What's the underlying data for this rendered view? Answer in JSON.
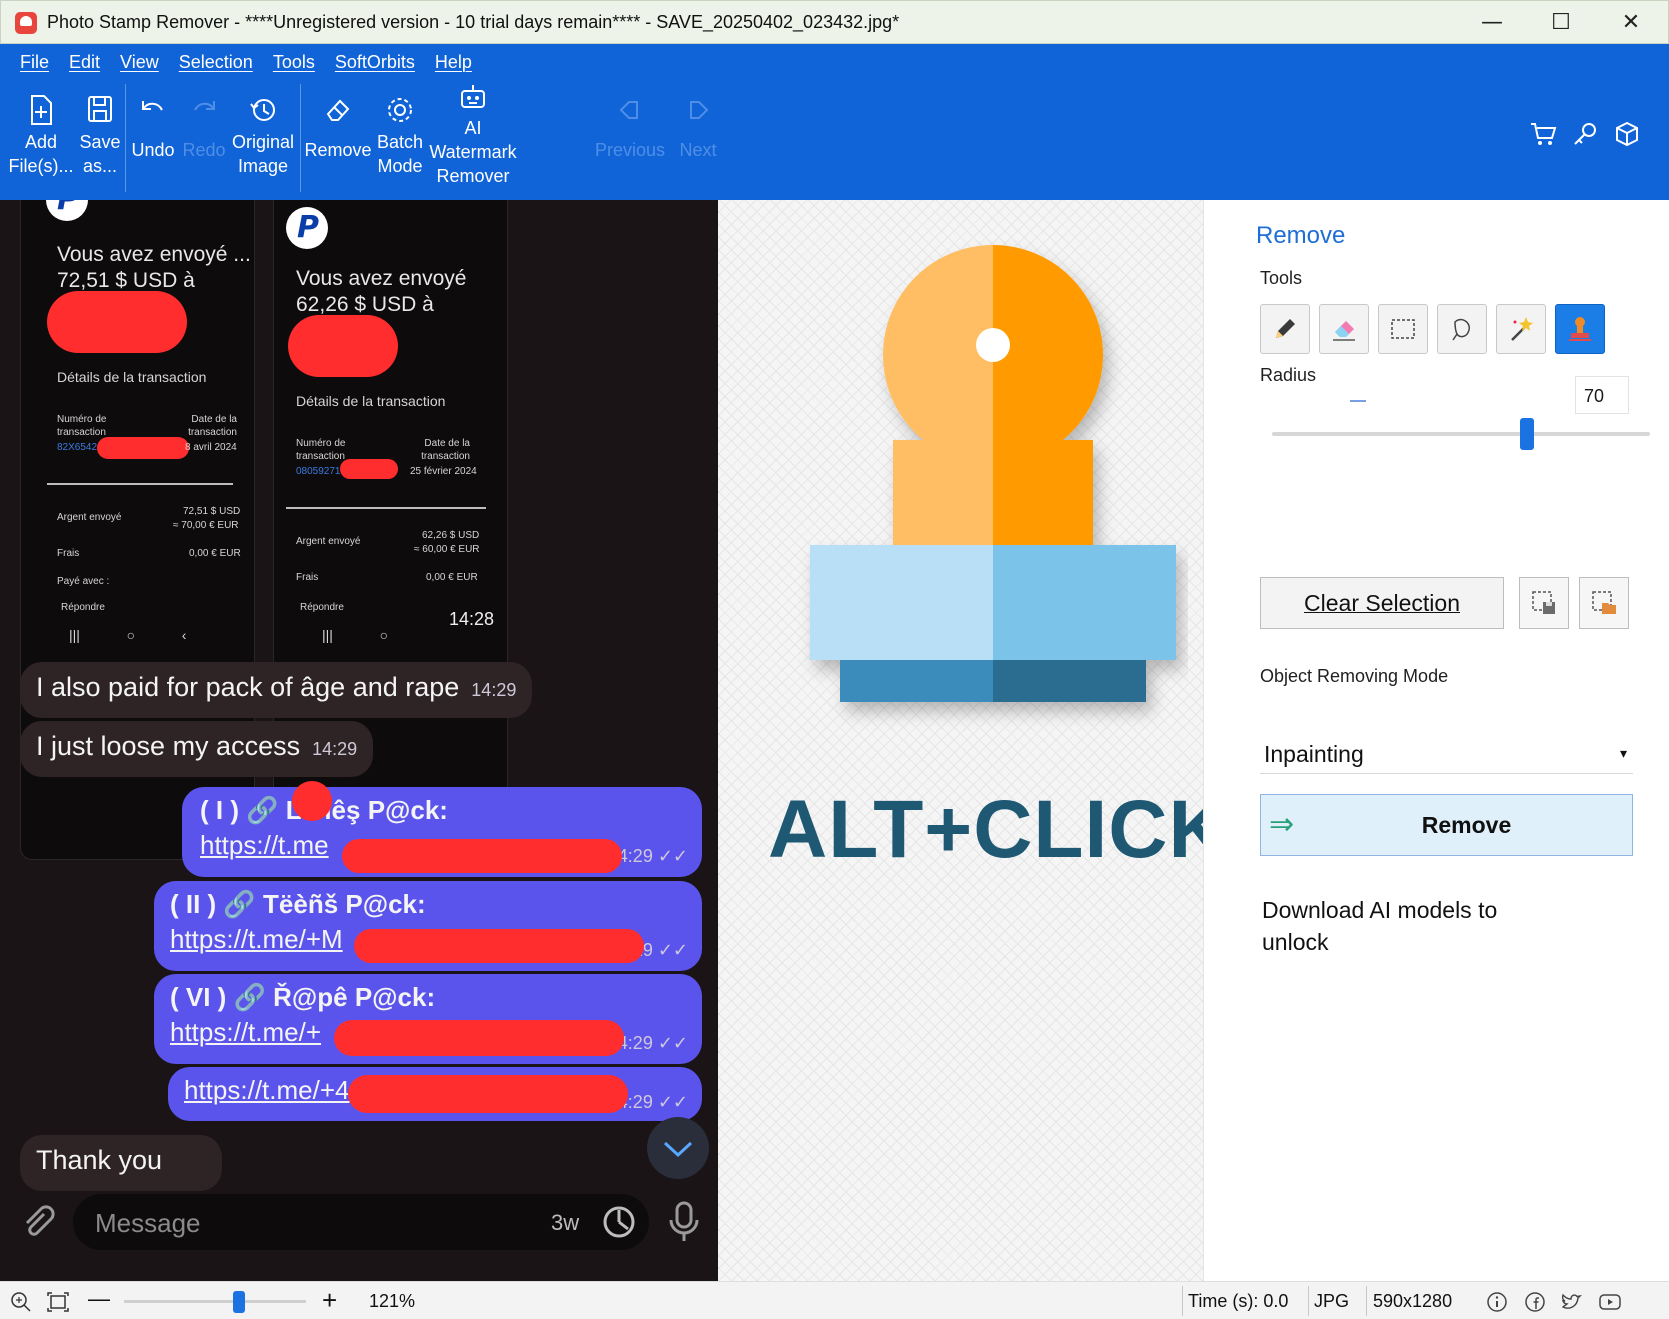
{
  "window": {
    "title": "Photo Stamp Remover - ****Unregistered version - 10 trial days remain**** - SAVE_20250402_023432.jpg*",
    "minimize": "—",
    "maximize": "☐",
    "close": "✕"
  },
  "menu": [
    "File",
    "Edit",
    "View",
    "Selection",
    "Tools",
    "SoftOrbits",
    "Help"
  ],
  "toolbar": {
    "add_line1": "Add",
    "add_line2": "File(s)...",
    "save_line1": "Save",
    "save_line2": "as...",
    "undo": "Undo",
    "redo": "Redo",
    "original_line1": "Original",
    "original_line2": "Image",
    "remove": "Remove",
    "batch_line1": "Batch",
    "batch_line2": "Mode",
    "ai_line1": "AI",
    "ai_line2": "Watermark",
    "ai_line3": "Remover",
    "previous": "Previous",
    "next": "Next",
    "right_icons": [
      "cart-icon",
      "key-icon",
      "box-icon"
    ]
  },
  "image_left": {
    "card1": {
      "title_line1": "Vous avez envoyé ...",
      "title_line2": "72,51 $ USD à",
      "details": "Détails de la transaction",
      "num_label": "Numéro de transaction",
      "num_value": "82X6542",
      "date_label": "Date de la transaction",
      "date_value": "8 avril 2024",
      "sent_label": "Argent envoyé",
      "sent_value1": "72,51 $ USD",
      "sent_value2": "≈ 70,00 € EUR",
      "fees_label": "Frais",
      "fees_value": "0,00 € EUR",
      "paid_with": "Payé avec :",
      "reply": "Répondre"
    },
    "card2": {
      "title_line1": "Vous avez envoyé",
      "title_line2": "62,26 $ USD à",
      "details": "Détails de la transaction",
      "num_label": "Numéro de transaction",
      "num_value": "08059271",
      "date_label": "Date de la transaction",
      "date_value": "25 février 2024",
      "sent_label": "Argent envoyé",
      "sent_value1": "62,26 $ USD",
      "sent_value2": "≈ 60,00 € EUR",
      "fees_label": "Frais",
      "fees_value": "0,00 € EUR",
      "reply": "Répondre",
      "time": "14:28"
    },
    "messages": [
      {
        "text": "I also paid for pack of âge and rape",
        "time": "14:29"
      },
      {
        "text": "I just loose my access",
        "time": "14:29"
      }
    ],
    "links": [
      {
        "title": "( I ) 🔗 L    biêş P@ck:",
        "url": "https://t.me",
        "time": "4:29 ✓✓"
      },
      {
        "title": "( II ) 🔗 Tëèñš P@ck:",
        "url": "https://t.me/+M",
        "time": "29 ✓✓"
      },
      {
        "title": "( VI ) 🔗 Ř@pê P@ck:",
        "url": "https://t.me/+",
        "time": "14:29 ✓✓"
      },
      {
        "title": "",
        "url": "https://t.me/+4",
        "time": "14:29 ✓✓"
      }
    ],
    "thank_you": "Thank you",
    "message_placeholder": "Message",
    "message_timer": "3w"
  },
  "image_right": {
    "caption": "ALT+CLICK"
  },
  "panel": {
    "title": "Remove",
    "tools_label": "Tools",
    "tools": [
      "pencil-icon",
      "eraser-icon",
      "rect-select-icon",
      "lasso-icon",
      "magic-wand-icon",
      "stamp-icon"
    ],
    "radius_label": "Radius",
    "radius_value": "70",
    "radius_fraction": 0.68,
    "clear_selection": "Clear Selection",
    "mode_label": "Object Removing Mode",
    "mode_value": "Inpainting",
    "remove_button": "Remove",
    "download_text": "Download AI models to unlock"
  },
  "status": {
    "zoom": "121%",
    "zoom_fraction": 0.64,
    "time": "Time (s): 0.0",
    "format": "JPG",
    "dimensions": "590x1280"
  },
  "colors": {
    "ribbon": "#1064d8",
    "accent": "#1a73e0",
    "stamp_orange_light": "#ffbe64",
    "stamp_orange_dark": "#ff9a00",
    "stamp_blue_light": "#b9dff6",
    "stamp_blue_dark": "#2a6d90",
    "caption": "#1e5872"
  }
}
